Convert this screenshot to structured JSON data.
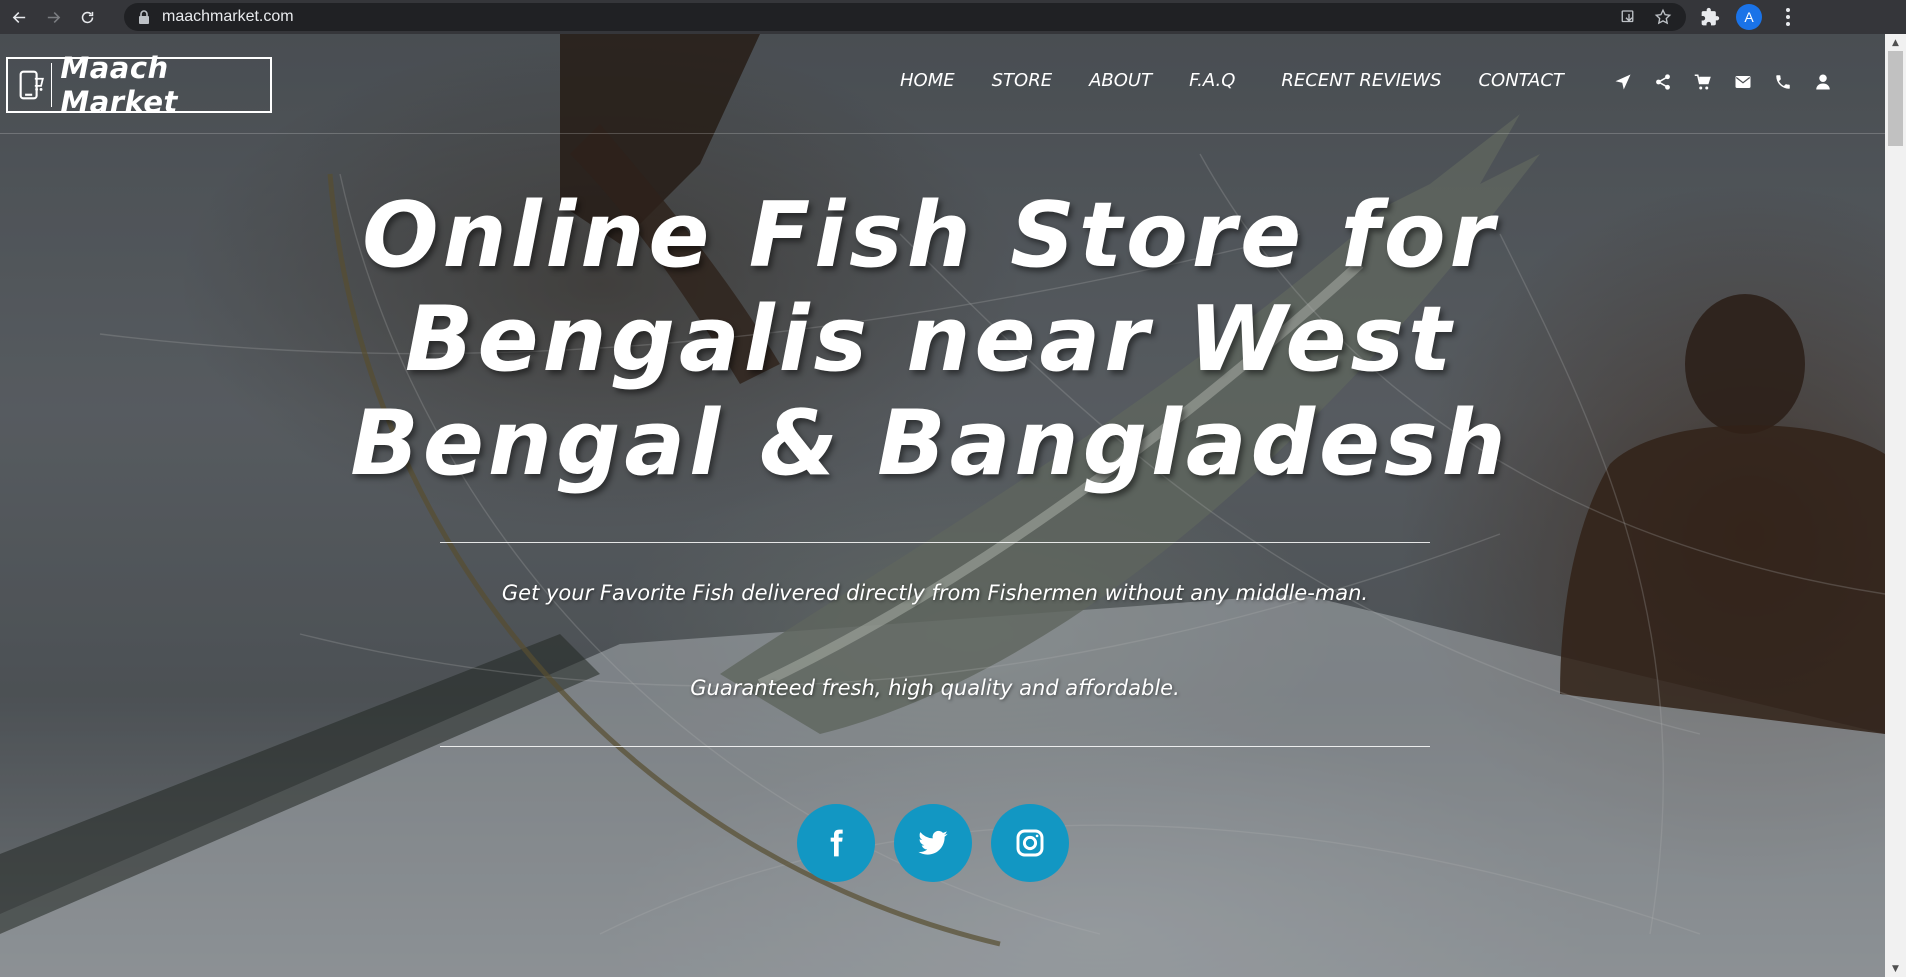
{
  "browser": {
    "url": "maachmarket.com",
    "profile_initial": "A"
  },
  "site": {
    "logo_text": "Maach Market",
    "nav": [
      {
        "label": "HOME"
      },
      {
        "label": "STORE"
      },
      {
        "label": "ABOUT"
      },
      {
        "label": "F.A.Q"
      },
      {
        "label": "RECENT REVIEWS"
      },
      {
        "label": "CONTACT"
      }
    ],
    "header_icons": [
      "location-arrow-icon",
      "share-icon",
      "cart-icon",
      "envelope-icon",
      "phone-icon",
      "user-icon"
    ]
  },
  "hero": {
    "title_line1": "Online Fish Store for",
    "title_line2": "Bengalis near West",
    "title_line3": "Bengal & Bangladesh",
    "subtitle1": "Get your Favorite Fish delivered directly from Fishermen without any middle-man.",
    "subtitle2": "Guaranteed fresh, high quality and affordable."
  },
  "socials": [
    "facebook-icon",
    "twitter-icon",
    "instagram-icon"
  ],
  "colors": {
    "social_bg": "#1297c3",
    "chrome_bg": "#35363a",
    "omnibox_bg": "#202124",
    "text": "#ffffff"
  }
}
